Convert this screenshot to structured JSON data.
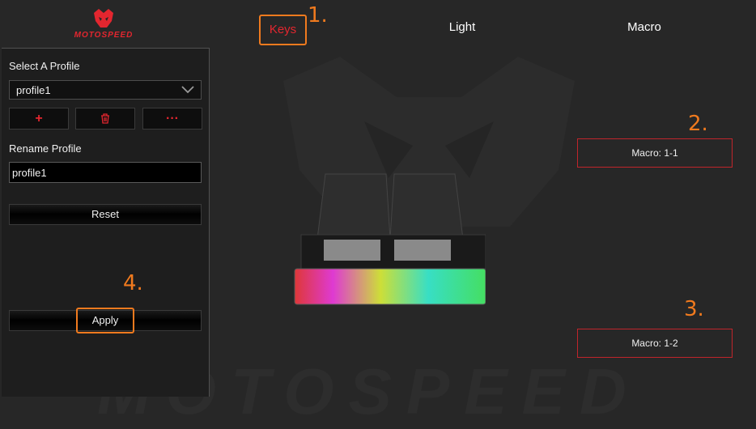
{
  "brand": {
    "logo_text": "MOTOSPEED",
    "accent": "#e3262f"
  },
  "nav": {
    "tabs": [
      {
        "label": "Keys",
        "active": true
      },
      {
        "label": "Light",
        "active": false
      },
      {
        "label": "Macro",
        "active": false
      }
    ]
  },
  "sidebar": {
    "select_profile_label": "Select A Profile",
    "profile_select_value": "profile1",
    "add_icon": "+",
    "delete_icon": "trash-icon",
    "more_icon": "···",
    "rename_label": "Rename Profile",
    "rename_value": "profile1",
    "reset_label": "Reset",
    "apply_label": "Apply"
  },
  "macros": {
    "key1": "Macro: 1-1",
    "key2": "Macro: 1-2"
  },
  "annotations": {
    "one": "1.",
    "two": "2.",
    "three": "3.",
    "four": "4."
  },
  "colors": {
    "background": "#272727",
    "sidebar": "#1e1e1e",
    "annotation": "#f07a1e"
  }
}
